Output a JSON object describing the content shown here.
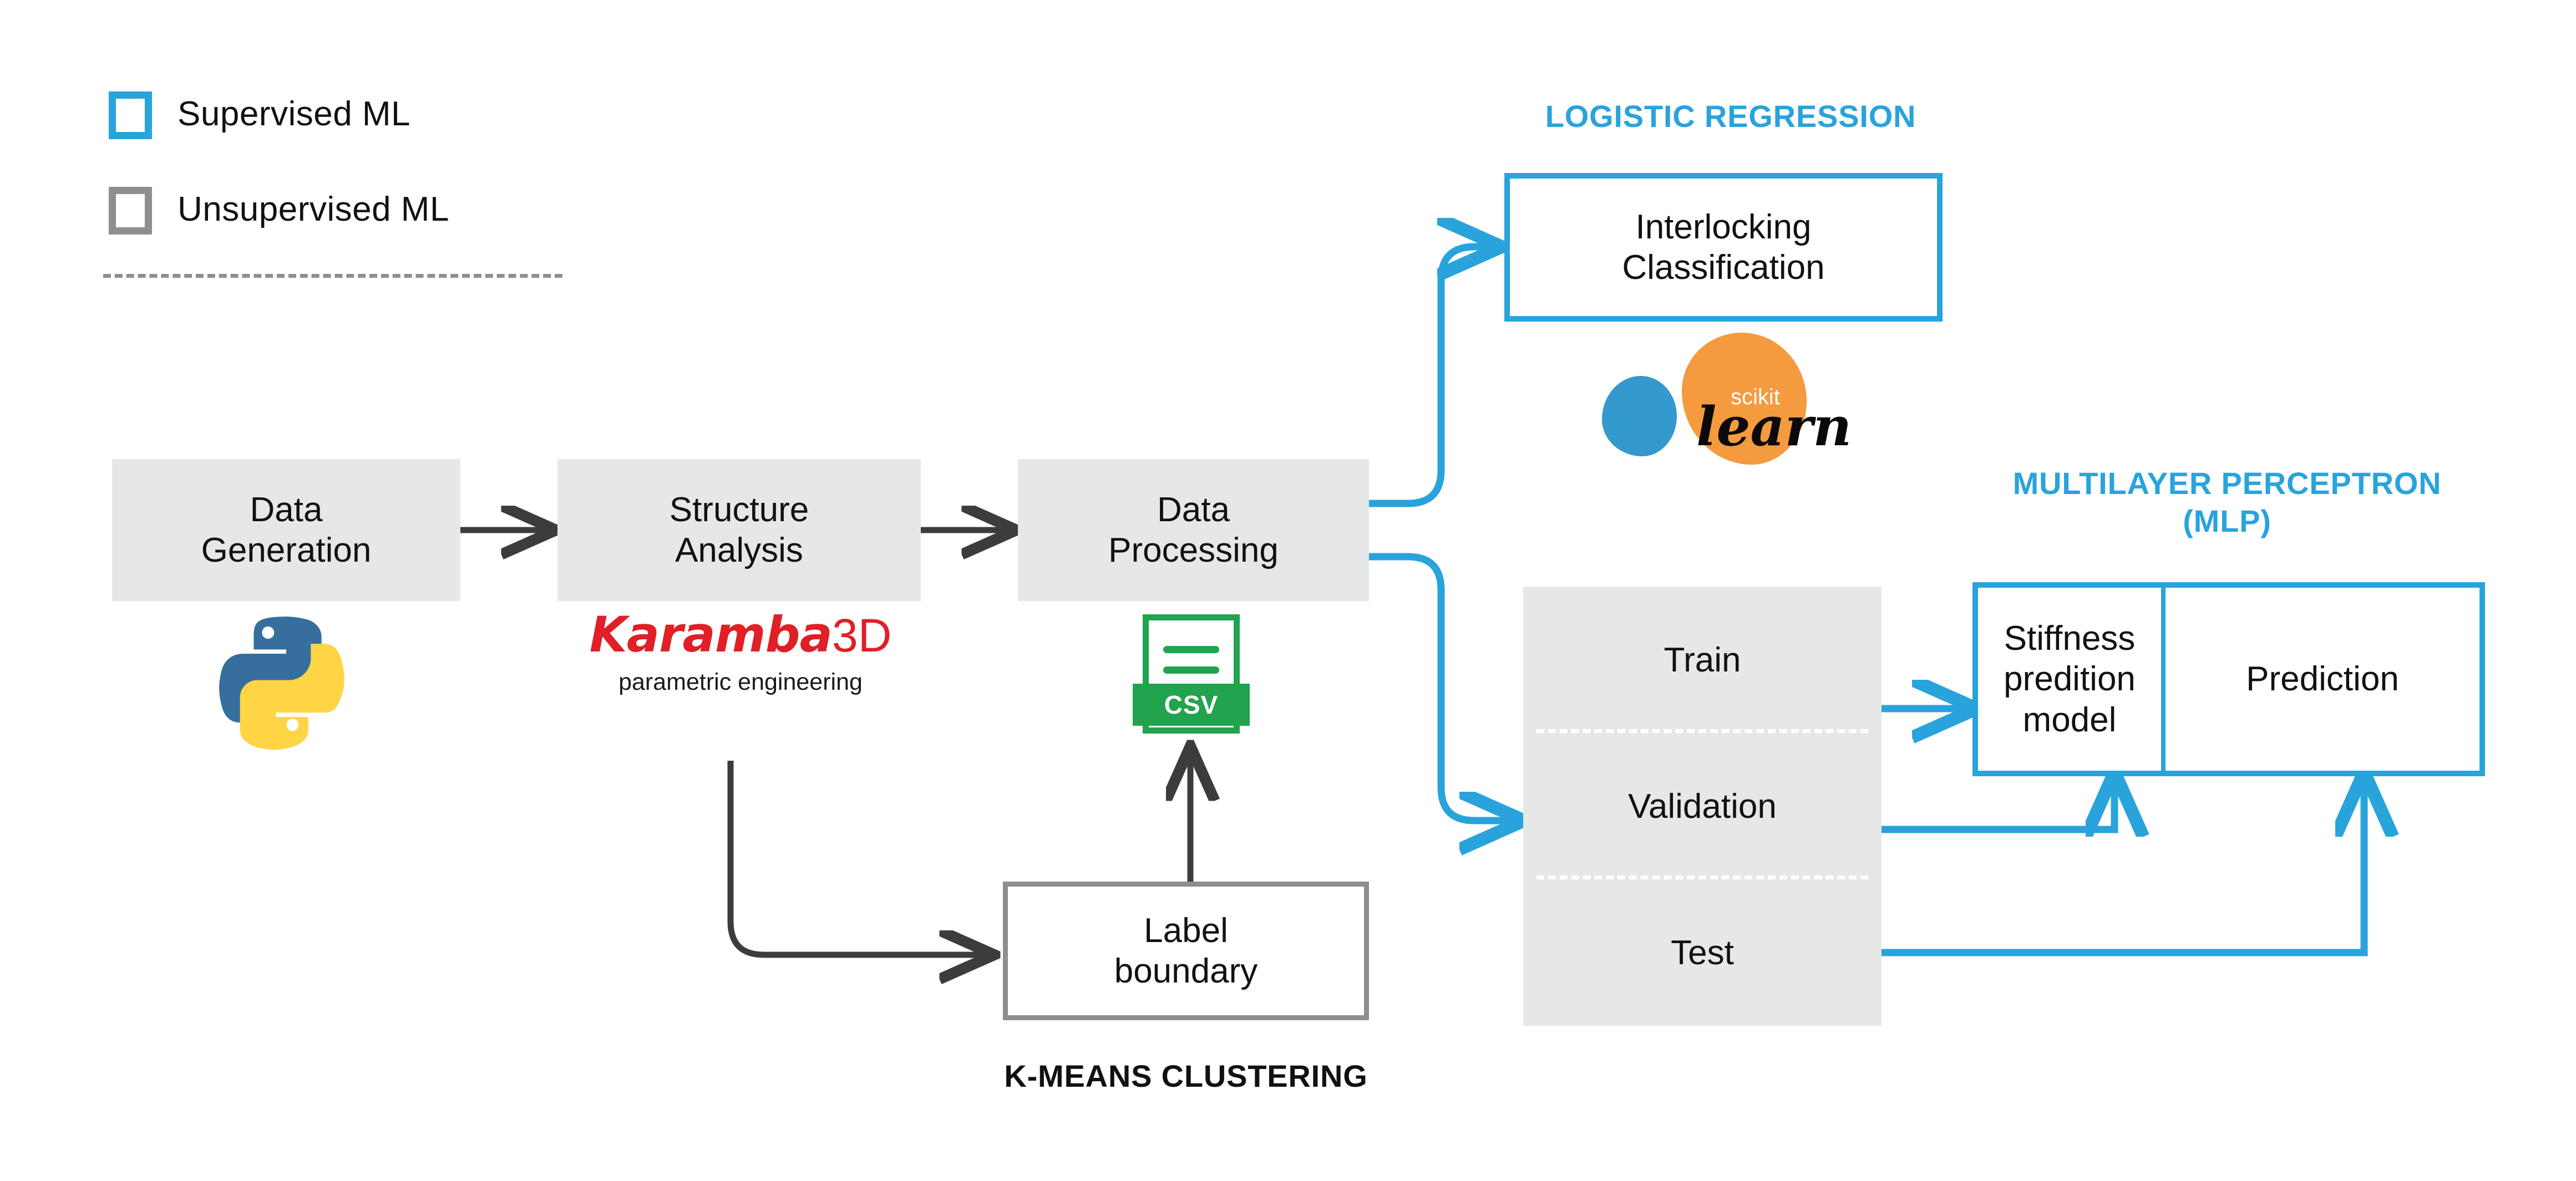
{
  "legend": {
    "items": [
      {
        "label": "Supervised ML",
        "color": "#29a3dc",
        "swatch": "legend-swatch-supervised"
      },
      {
        "label": "Unsupervised ML",
        "color": "#8e8e8e",
        "swatch": "legend-swatch-unsupervised"
      }
    ]
  },
  "pipeline": {
    "data_generation": "Data\nGeneration",
    "structure_analysis": "Structure\nAnalysis",
    "data_processing": "Data\nProcessing",
    "label_boundary": "Label\nboundary"
  },
  "logos": {
    "python": "python-logo",
    "karamba_word": "Karamba",
    "karamba_3d": "3D",
    "karamba_tagline": "parametric engineering",
    "csv": "CSV",
    "scikit": "scikit",
    "learn": "learn"
  },
  "logistic_regression": {
    "title": "LOGISTIC REGRESSION",
    "box_label": "Interlocking\nClassification"
  },
  "kmeans": {
    "title": "K-MEANS CLUSTERING"
  },
  "mlp": {
    "title": "MULTILAYER PERCEPTRON\n(MLP)",
    "dataset_split": [
      "Train",
      "Validation",
      "Test"
    ],
    "model_label": "Stiffness\npredition\nmodel",
    "prediction_label": "Prediction"
  },
  "colors": {
    "supervised_blue": "#29a3dc",
    "unsupervised_gray": "#8e8e8e",
    "box_fill": "#e6e7e7",
    "arrow_dark": "#3c3c3c",
    "karamba_red": "#e01f26",
    "csv_green": "#22a34e",
    "scikit_orange": "#f49a3f",
    "scikit_blue": "#3499cd",
    "python_blue": "#366f9e",
    "python_yellow": "#ffd develop"
  }
}
